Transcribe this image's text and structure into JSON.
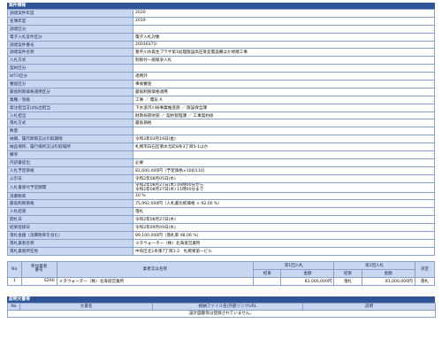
{
  "info_section": {
    "title": "案件情報",
    "rows": [
      {
        "label": "調達案件年度",
        "value": "2020"
      },
      {
        "label": "名簿年度",
        "value": "2019"
      },
      {
        "label": "調達区分",
        "value": ""
      },
      {
        "label": "電子入札案件区分",
        "value": "電子入札対象"
      },
      {
        "label": "調達案件番号",
        "value": "20030371l"
      },
      {
        "label": "調達案件名称",
        "value": "豊平川水再生プラザ第1処理施設高圧受変電設備ほか修繕工事"
      },
      {
        "label": "入札方式",
        "value": "制限付一般競争入札"
      },
      {
        "label": "契約区分",
        "value": ""
      },
      {
        "label": "WTO区分",
        "value": "適用外"
      },
      {
        "label": "審査区分",
        "value": "事後審査"
      },
      {
        "label": "最低制限価格適用区分",
        "value": "最低制限価格適用"
      },
      {
        "label": "業種／等級",
        "value": "工事 ／ 電気 A"
      },
      {
        "label": "発注担当又は払出担当",
        "value": "下水道河川局事業推進部 ／ 施設保全課"
      },
      {
        "label": "入札担当",
        "value": "財政局管財部 ／ 契約管理課 ／ 工事契約係"
      },
      {
        "label": "落札方式",
        "value": "最低価格"
      },
      {
        "label": "数量",
        "value": ""
      },
      {
        "label": "納期、履行期限又は引取期限",
        "value": "令和3年03月19日(金)"
      },
      {
        "label": "納品場所、履行場所又は引取場所",
        "value": "札幌市白石区菊水元町8条3丁目5-1ほか"
      },
      {
        "label": "備考",
        "value": ""
      },
      {
        "label": "内訳書提出",
        "value": "必要"
      },
      {
        "label": "入札予定価格",
        "value": "82,600,000円（予定価格×100/110）"
      },
      {
        "label": "公示日",
        "value": "令和2年08月05日(水)"
      },
      {
        "label": "入札書受付予定期間",
        "value": "令和2年08月27日(木) 09時00分から\n令和2年08月27日(木) 11時00分まで"
      },
      {
        "label": "消費税率",
        "value": "10 %"
      },
      {
        "label": "最低制限価格",
        "value": "75,992,000円（入札書比較価格 × 92.00 %）"
      },
      {
        "label": "入札結果",
        "value": "落札"
      },
      {
        "label": "開札日",
        "value": "令和2年08月27日(木)"
      },
      {
        "label": "結果登録日",
        "value": "令和2年09月09日(水)"
      },
      {
        "label": "落札金額（消費税率を含む）",
        "value": "89,100,000円（落札率 98.06 %）"
      },
      {
        "label": "落札業者名称",
        "value": "メタウォーター（株）北海道営業所"
      },
      {
        "label": "落札業者所在地",
        "value": "中央区北1条東7丁目1-2　札幌東第一ビル"
      }
    ]
  },
  "bids": {
    "headers": {
      "no": "No",
      "vendor_no": "参加業者\n番号",
      "vendor_name": "業者又は名称",
      "round1": "第1回入札",
      "round2": "第2回入札",
      "decision": "決定",
      "result": "結果",
      "amount": "金額"
    },
    "rows": [
      {
        "no": "1",
        "vendor_no": "6290",
        "vendor_name": "メタウォーター（株）北海道営業所",
        "r1_result": "",
        "r1_amount": "83,000,000円",
        "r2_result": "落札",
        "r2_amount": "81,000,000円",
        "decision": "落札"
      }
    ]
  },
  "docs_section": {
    "title": "説明文書等",
    "headers": {
      "no": "No",
      "doc_name": "文書名",
      "link": "格納ファイル名/外部リンクURL",
      "desc": "説明"
    },
    "empty_message": "設計図書等は登録されていません。"
  },
  "colors": {
    "header_bg": "#2f5597",
    "label_bg": "#c9d7f0",
    "border": "#8aa0c8"
  }
}
